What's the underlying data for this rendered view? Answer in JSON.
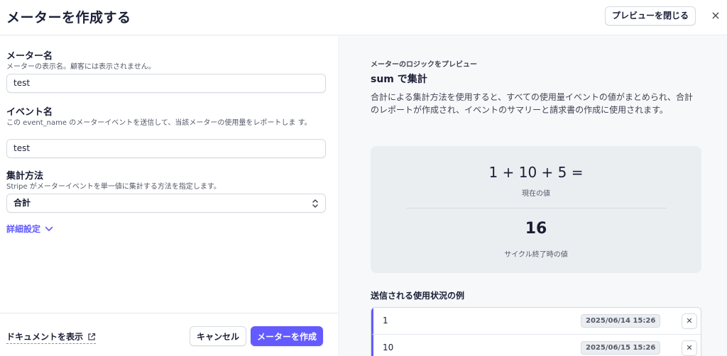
{
  "header": {
    "title": "メーターを作成する",
    "close_preview_label": "プレビューを閉じる",
    "close_icon": "×"
  },
  "form": {
    "meter_name": {
      "label": "メーター名",
      "help": "メーターの表示名。顧客には表示されません。",
      "value": "test"
    },
    "event_name": {
      "label": "イベント名",
      "help": "この event_name のメーターイベントを送信して、当該メーターの使用量をレポートしま す。",
      "value": "test"
    },
    "aggregation": {
      "label": "集計方法",
      "help": "Stripe がメーターイベントを単一値に集計する方法を指定します。",
      "value": "合計"
    },
    "advanced_label": "詳細設定"
  },
  "footer": {
    "docs_label": "ドキュメントを表示",
    "cancel_label": "キャンセル",
    "create_label": "メーターを作成"
  },
  "preview": {
    "eyebrow": "メーターのロジックをプレビュー",
    "heading": "sum で集計",
    "description": "合計による集計方法を使用すると、すべての使用量イベントの値がまとめられ、合計のレポートが作成され、イベントのサマリーと請求書の作成に使用されます。",
    "expression": "1 + 10 + 5 =",
    "current_caption": "現在の値",
    "total": "16",
    "cycle_caption": "サイクル終了時の値",
    "examples_title": "送信される使用状況の例",
    "examples": [
      {
        "value": "1",
        "timestamp": "2025/06/14 15:26"
      },
      {
        "value": "10",
        "timestamp": "2025/06/15 15:26"
      }
    ]
  },
  "colors": {
    "accent": "#635bff",
    "text": "#1a1f36",
    "panel": "#f6f8fa"
  }
}
